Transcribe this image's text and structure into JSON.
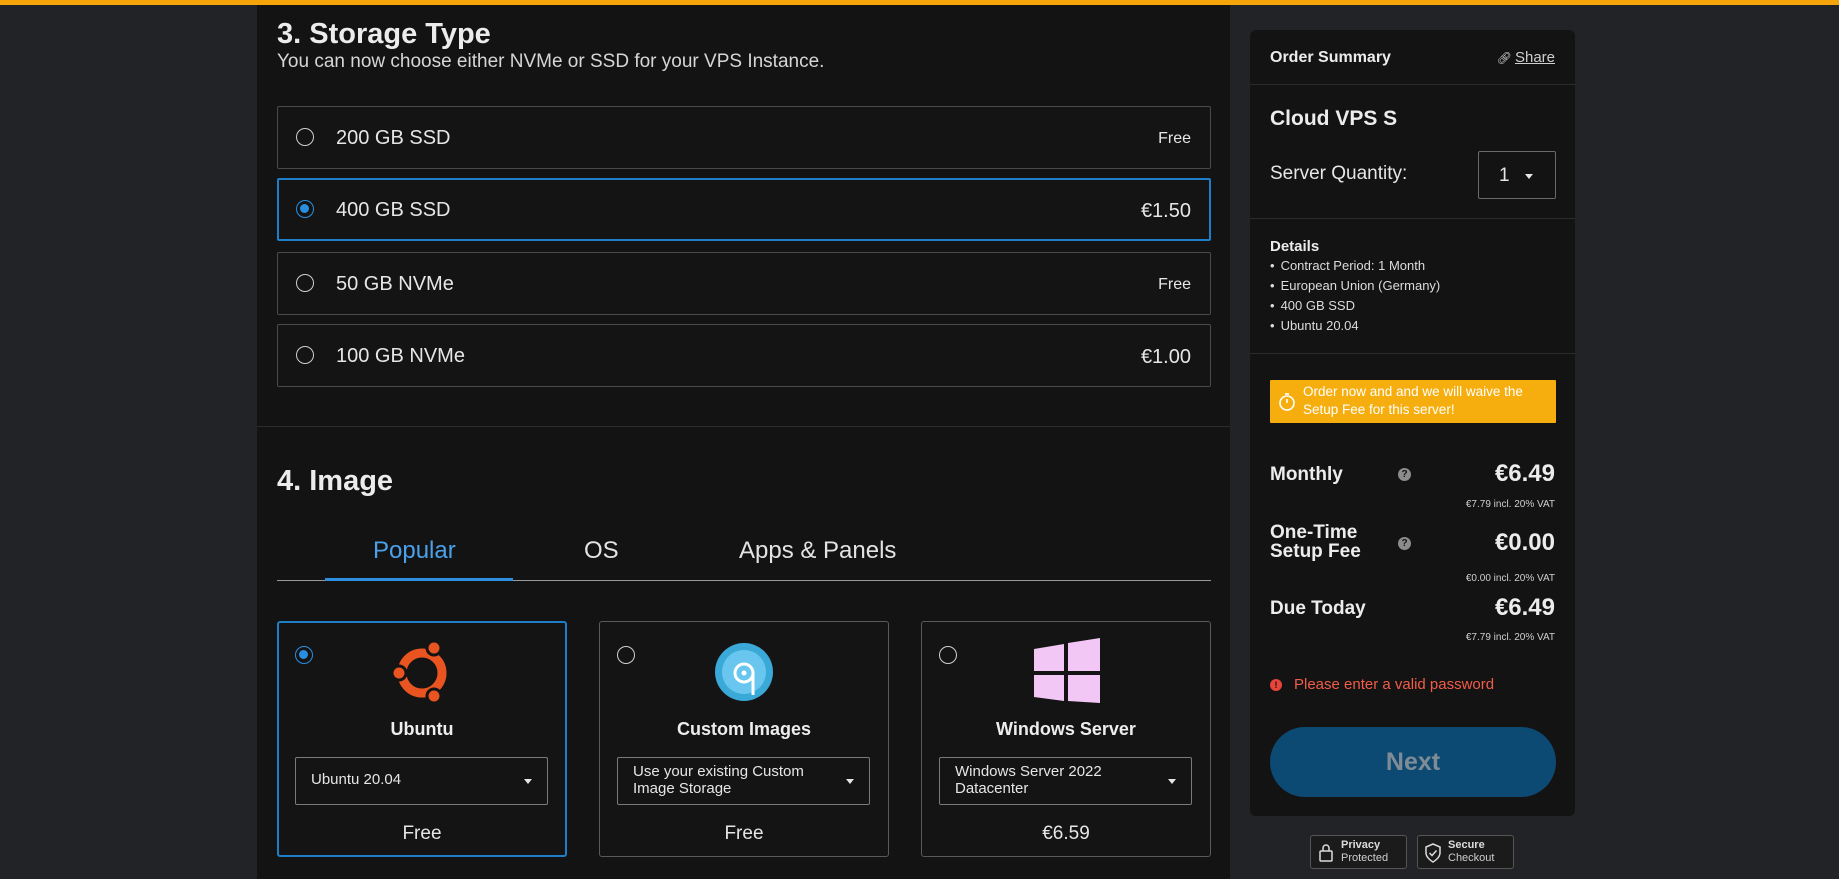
{
  "storage": {
    "title": "3. Storage Type",
    "subtitle": "You can now choose either NVMe or SSD for your VPS Instance.",
    "options": [
      {
        "label": "200 GB SSD",
        "price": "Free",
        "selected": false
      },
      {
        "label": "400 GB SSD",
        "price": "€1.50",
        "selected": true
      },
      {
        "label": "50 GB NVMe",
        "price": "Free",
        "selected": false
      },
      {
        "label": "100 GB NVMe",
        "price": "€1.00",
        "selected": false
      }
    ]
  },
  "image": {
    "title": "4. Image",
    "tabs": [
      {
        "label": "Popular",
        "active": true
      },
      {
        "label": "OS",
        "active": false
      },
      {
        "label": "Apps & Panels",
        "active": false
      }
    ],
    "cards": [
      {
        "name": "Ubuntu",
        "select_value": "Ubuntu 20.04",
        "price": "Free",
        "icon": "ubuntu-logo-icon",
        "selected": true
      },
      {
        "name": "Custom Images",
        "select_value": "Use your existing Custom Image Storage",
        "price": "Free",
        "icon": "custom-image-icon",
        "selected": false
      },
      {
        "name": "Windows Server",
        "select_value": "Windows Server 2022 Datacenter",
        "price": "€6.59",
        "icon": "windows-logo-icon",
        "selected": false
      }
    ]
  },
  "summary": {
    "heading": "Order Summary",
    "share": "Share",
    "product": "Cloud VPS S",
    "quantity_label": "Server Quantity:",
    "quantity": "1",
    "details_label": "Details",
    "details": [
      "Contract Period: 1 Month",
      "European Union (Germany)",
      "400 GB SSD",
      "Ubuntu 20.04"
    ],
    "promo": "Order now and and we will waive the Setup Fee for this server!",
    "monthly_label": "Monthly",
    "monthly": "€6.49",
    "monthly_vat": "€7.79 incl. 20% VAT",
    "setup_label_1": "One-Time",
    "setup_label_2": "Setup Fee",
    "setup": "€0.00",
    "setup_vat": "€0.00 incl. 20% VAT",
    "due_label": "Due Today",
    "due": "€6.49",
    "due_vat": "€7.79 incl. 20% VAT",
    "error": "Please enter a valid password",
    "next": "Next"
  },
  "badges": {
    "privacy_1": "Privacy",
    "privacy_2": "Protected",
    "secure_1": "Secure",
    "secure_2": "Checkout"
  },
  "colors": {
    "accent": "#f5a40a",
    "primary": "#2a8ee0",
    "error": "#f25c4a"
  }
}
